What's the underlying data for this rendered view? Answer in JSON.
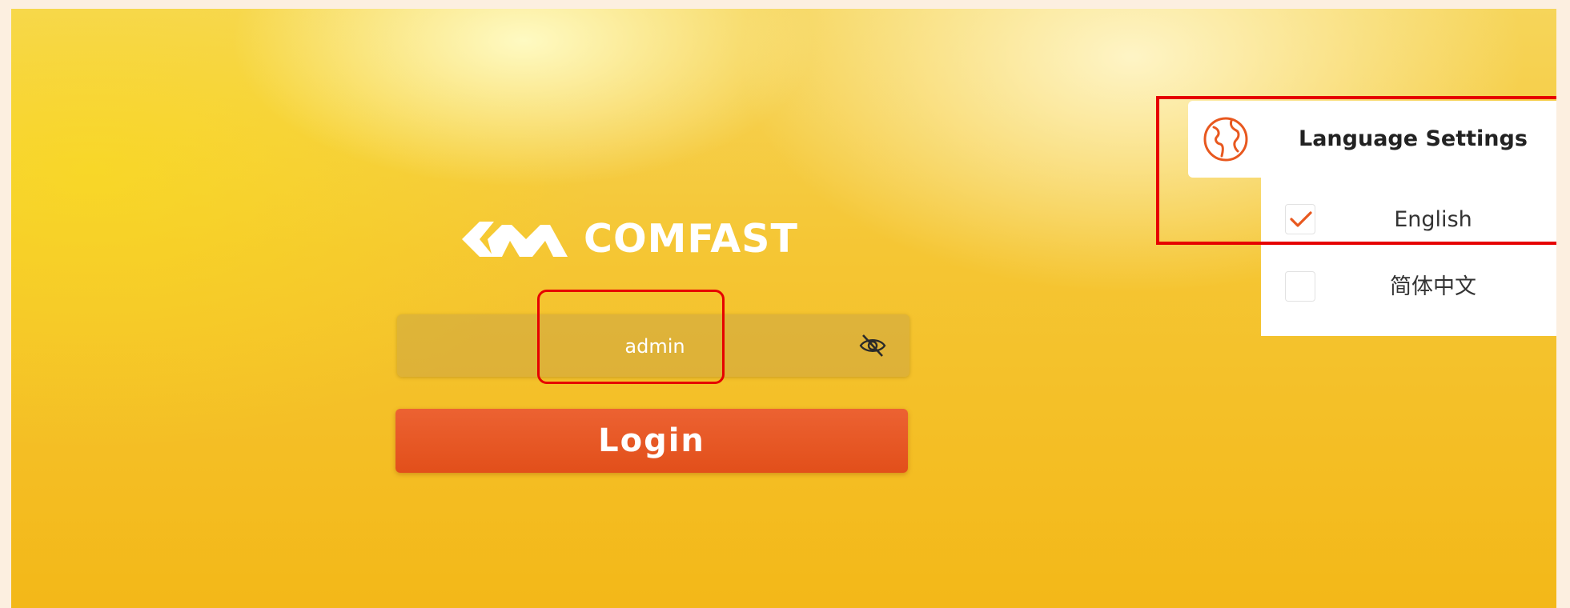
{
  "logo": {
    "brand_text": "COMFAST"
  },
  "login_form": {
    "password_value": "admin",
    "login_label": "Login"
  },
  "language": {
    "title": "Language Settings",
    "options": [
      {
        "label": "English",
        "selected": true
      },
      {
        "label": "简体中文",
        "selected": false
      }
    ]
  },
  "colors": {
    "accent": "#e8581f",
    "highlight": "#e60000",
    "background": "#f5c634"
  },
  "icons": {
    "password_toggle": "eye-slash-icon",
    "language": "globe-icon",
    "selected": "checkmark-icon"
  }
}
